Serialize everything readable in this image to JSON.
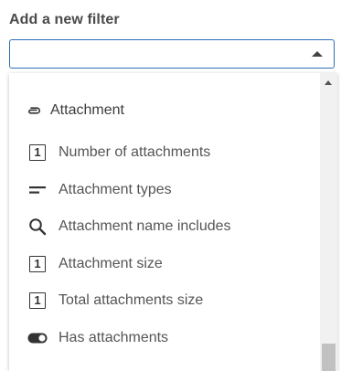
{
  "filter": {
    "label": "Add a new filter",
    "selected_value": ""
  },
  "dropdown": {
    "group": {
      "label": "Attachment",
      "icon": "paperclip-icon"
    },
    "options": [
      {
        "label": "Number of attachments",
        "icon": "number-box-icon",
        "badge": "1"
      },
      {
        "label": "Attachment types",
        "icon": "text-lines-icon"
      },
      {
        "label": "Attachment name includes",
        "icon": "search-icon"
      },
      {
        "label": "Attachment size",
        "icon": "number-box-icon",
        "badge": "1"
      },
      {
        "label": "Total attachments size",
        "icon": "number-box-icon",
        "badge": "1"
      },
      {
        "label": "Has attachments",
        "icon": "toggle-icon"
      }
    ]
  },
  "colors": {
    "focus_border": "#2d6fb5",
    "text": "#555555",
    "scrollbar_track": "#f1f1f1",
    "scrollbar_thumb": "#c1c1c1"
  }
}
